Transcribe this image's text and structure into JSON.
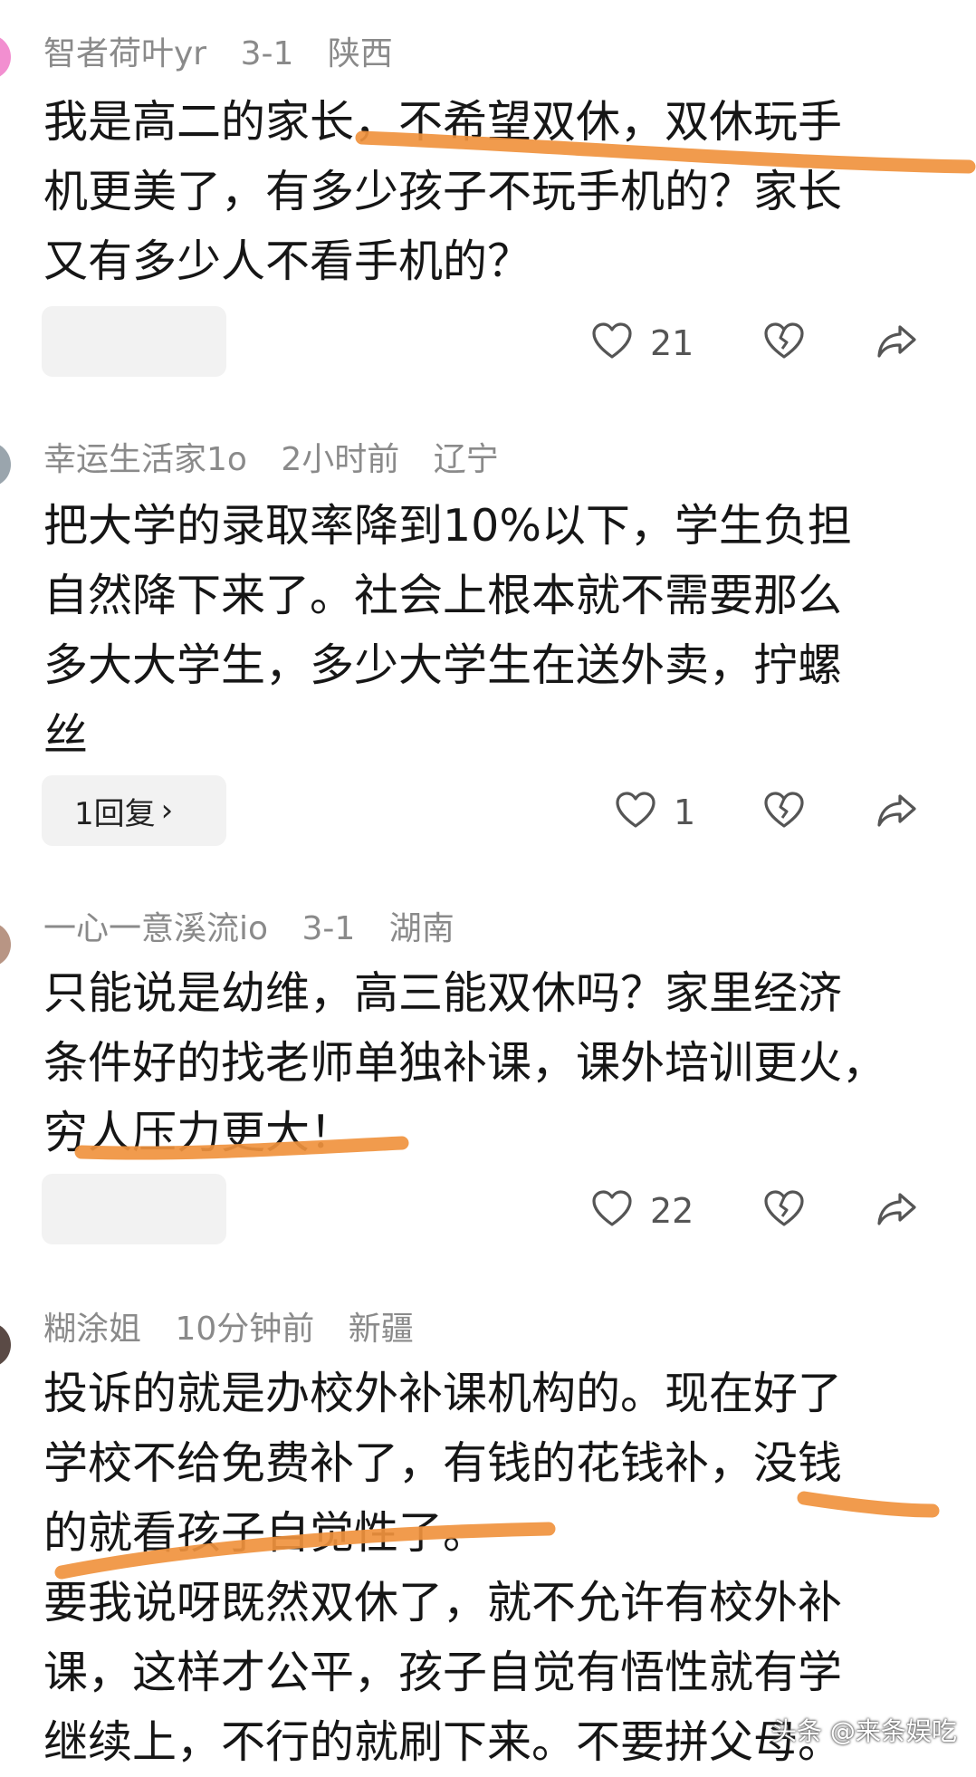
{
  "comments": [
    {
      "username": "智者荷叶yr",
      "time": "3-1",
      "location": "陕西",
      "lines": [
        "我是高二的家长，不希望双休，双休玩手",
        "机更美了，有多少孩子不玩手机的？家长",
        "又有多少人不看手机的？"
      ],
      "likes": "21",
      "reply_label": ""
    },
    {
      "username": "幸运生活家1o",
      "time": "2小时前",
      "location": "辽宁",
      "lines": [
        "把大学的录取率降到10%以下，学生负担",
        "自然降下来了。社会上根本就不需要那么",
        "多大大学生，多少大学生在送外卖，拧螺",
        "丝"
      ],
      "likes": "1",
      "reply_label": "1回复"
    },
    {
      "username": "一心一意溪流io",
      "time": "3-1",
      "location": "湖南",
      "lines": [
        "只能说是幼维，高三能双休吗？家里经济",
        "条件好的找老师单独补课，课外培训更火，",
        "穷人压力更大！"
      ],
      "likes": "22",
      "reply_label": ""
    },
    {
      "username": "糊涂姐",
      "time": "10分钟前",
      "location": "新疆",
      "lines": [
        "投诉的就是办校外补课机构的。现在好了",
        "学校不给免费补了，有钱的花钱补，没钱",
        "的就看孩子自觉性了。",
        "要我说呀既然双休了，就不允许有校外补",
        "课，这样才公平，孩子自觉有悟性就有学",
        "继续上，不行的就刷下来。不要拼父母。"
      ],
      "likes": "",
      "reply_label": ""
    }
  ],
  "icons": {
    "like": "heart-outline-icon",
    "dislike": "broken-heart-icon",
    "share": "share-arrow-icon",
    "chevron": "chevron-right-icon"
  },
  "chevron_glyph": "›",
  "watermark": "头条 @来条娱吃",
  "colors": {
    "text": "#161616",
    "meta": "#8a8a8a",
    "pill_bg": "#f2f2f2",
    "highlight": "#f0923e"
  }
}
